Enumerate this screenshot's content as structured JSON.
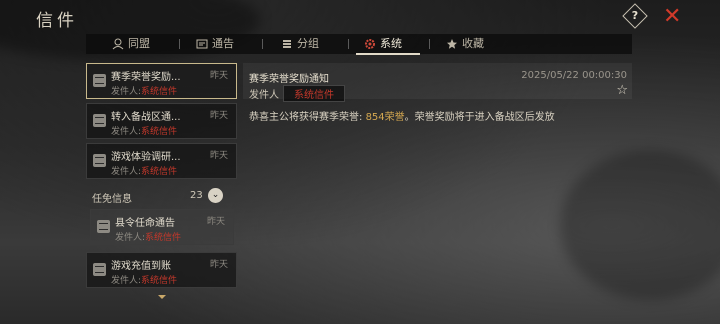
{
  "window": {
    "title": "信件"
  },
  "header": {
    "help_label": "?",
    "close_label": "✕",
    "accent": "#d23a2a"
  },
  "tabs": [
    {
      "label": "同盟",
      "icon": "alliance-icon",
      "active": false
    },
    {
      "label": "通告",
      "icon": "notice-icon",
      "active": false
    },
    {
      "label": "分组",
      "icon": "group-icon",
      "active": false
    },
    {
      "label": "系统",
      "icon": "gear-icon",
      "active": true
    },
    {
      "label": "收藏",
      "icon": "star-icon",
      "active": false
    }
  ],
  "mail_list": {
    "items": [
      {
        "subject": "赛季荣誉奖励...",
        "time": "昨天",
        "from_label": "发件人:",
        "from_value": "系统信件",
        "selected": true
      },
      {
        "subject": "转入备战区通...",
        "time": "昨天",
        "from_label": "发件人:",
        "from_value": "系统信件",
        "selected": false
      },
      {
        "subject": "游戏体验调研...",
        "time": "昨天",
        "from_label": "发件人:",
        "from_value": "系统信件",
        "selected": false
      }
    ],
    "group": {
      "label": "任免信息",
      "count": "23",
      "toggle": "⌄"
    },
    "group_items": [
      {
        "subject": "县令任命通告",
        "time": "昨天",
        "from_label": "发件人:",
        "from_value": "系统信件"
      }
    ],
    "more_items": [
      {
        "subject": "游戏充值到账",
        "time": "昨天",
        "from_label": "发件人:",
        "from_value": "系统信件"
      }
    ]
  },
  "detail": {
    "title": "赛季荣誉奖励通知",
    "timestamp": "2025/05/22 00:00:30",
    "from_label": "发件人",
    "from_value": "系统信件",
    "favorite_icon": "star-outline-icon",
    "body_prefix": "恭喜主公将获得赛季荣誉: ",
    "body_highlight": "854荣誉",
    "body_suffix": "。荣誉奖励将于进入备战区后发放"
  }
}
